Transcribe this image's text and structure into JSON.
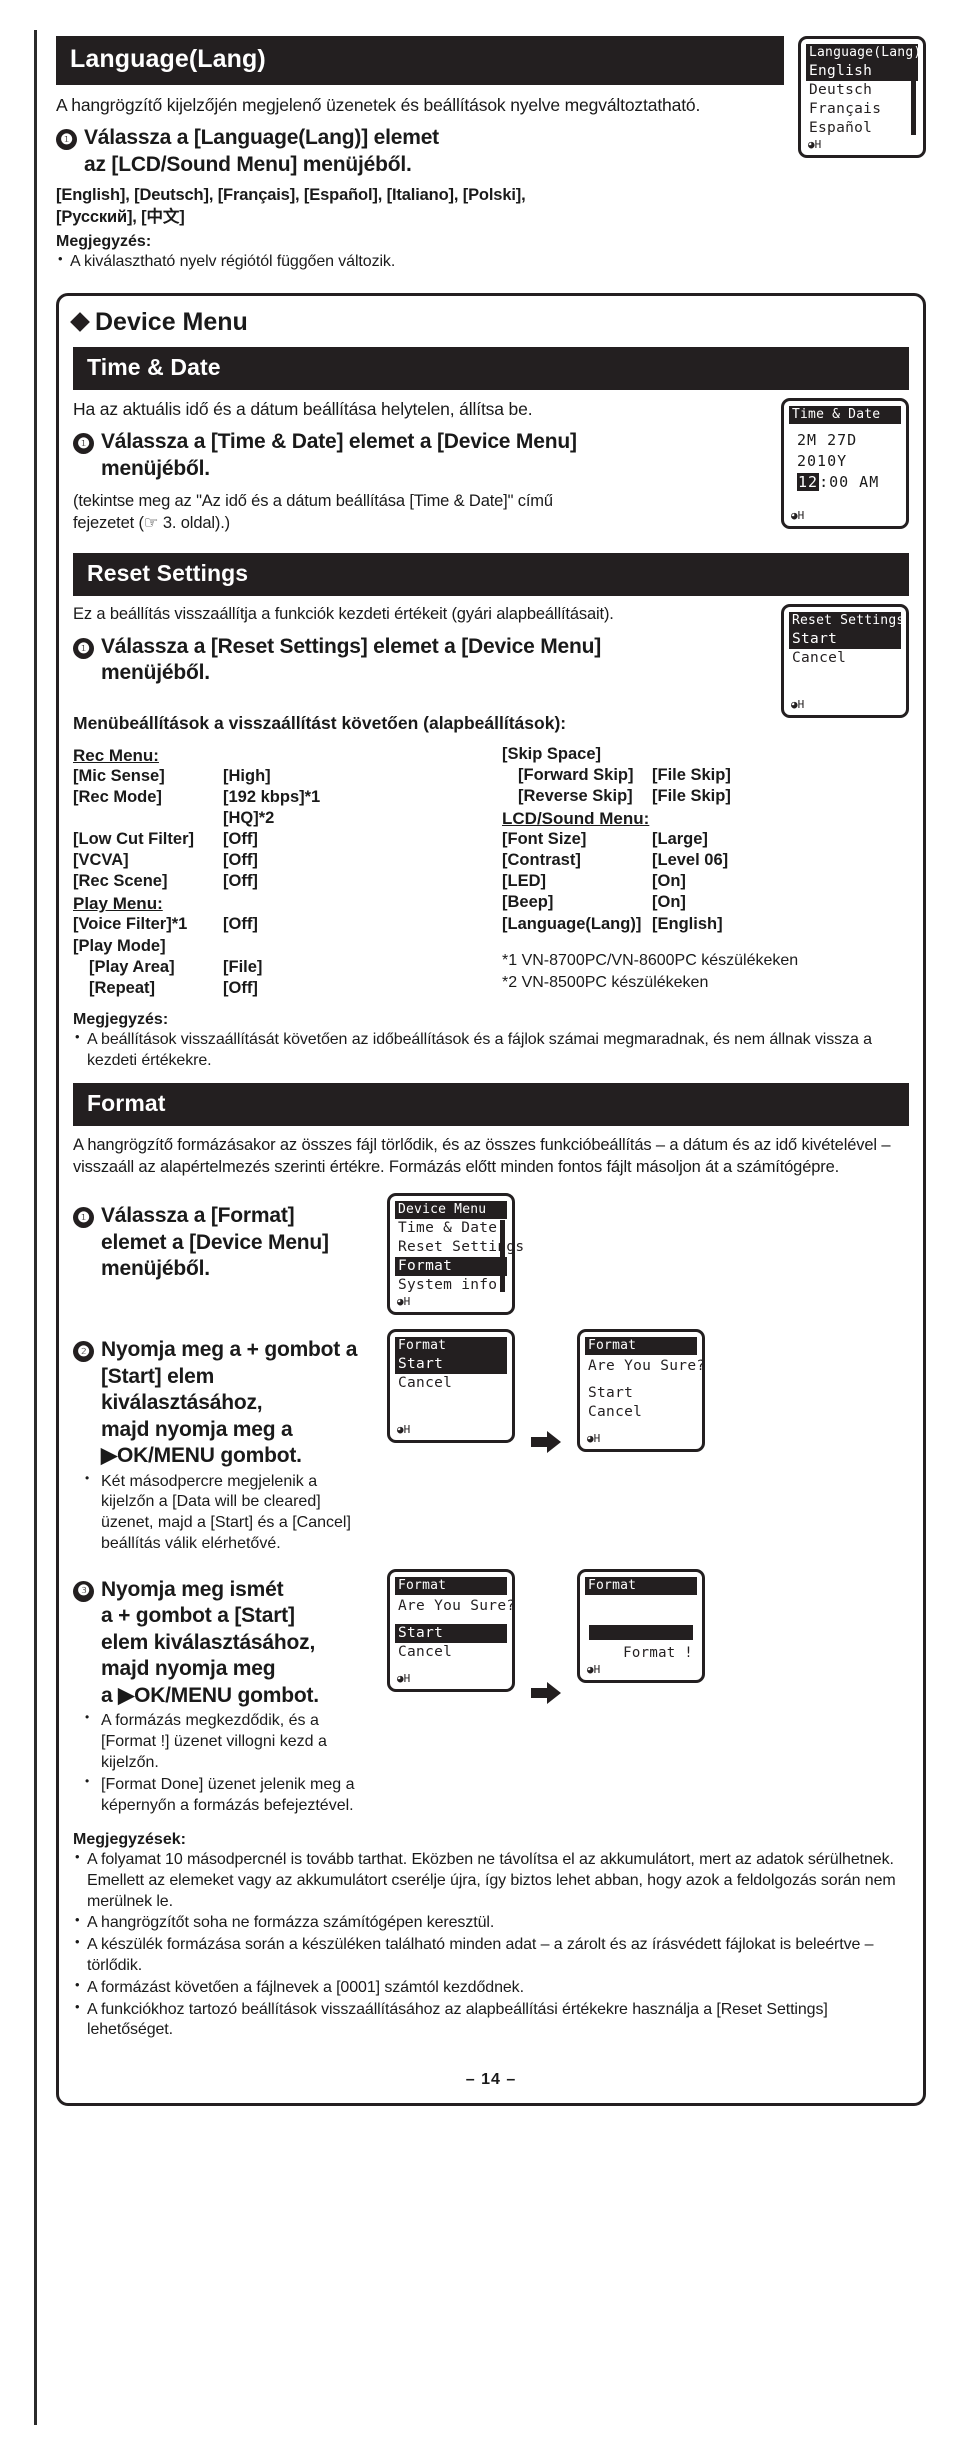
{
  "page_number": "– 14 –",
  "language_section": {
    "heading": "Language(Lang)",
    "intro": "A hangrögzítő kijelzőjén megjelenő üzenetek és beállítások nyelve megváltoztatható.",
    "step1_num": "❶",
    "step1_line1": "Válassza a [Language(Lang)] elemet",
    "step1_line2": "az [LCD/Sound Menu] menüjéből.",
    "options_line1": "[English], [Deutsch], [Français], [Español], [Italiano], [Polski],",
    "options_line2": "[Русский], [中文]",
    "note_heading": "Megjegyzés:",
    "note_item": "A kiválasztható nyelv régiótól függően változik.",
    "lcd": {
      "title": "Language(Lang)",
      "items": [
        "English",
        "Deutsch",
        "Français",
        "Español"
      ],
      "selected": "English",
      "footer": "H"
    }
  },
  "device_menu": {
    "title": "Device Menu",
    "time_date": {
      "heading": "Time & Date",
      "intro": "Ha az aktuális idő és a dátum beállítása helytelen, állítsa be.",
      "step1_num": "❶",
      "step1_line1": "Válassza a [Time & Date] elemet a [Device Menu]",
      "step1_line2": "menüjéből.",
      "ref_line1": "(tekintse meg az \"Az idő és a dátum beállítása [Time & Date]\" című",
      "ref_line2": "fejezetet (☞ 3. oldal).)",
      "lcd": {
        "title": "Time & Date",
        "date_line": "2M 27D 2010Y",
        "time_hl": "12",
        "time_rest": ":00 AM",
        "footer": "H"
      }
    },
    "reset_settings": {
      "heading": "Reset Settings",
      "intro": "Ez a beállítás visszaállítja a funkciók kezdeti értékeit (gyári alapbeállításait).",
      "step1_num": "❶",
      "step1_line1": "Válassza a [Reset Settings] elemet a [Device Menu]",
      "step1_line2": "menüjéből.",
      "defaults_heading": "Menübeállítások a visszaállítást követően (alapbeállítások):",
      "lcd": {
        "title": "Reset Settings",
        "items": [
          "Start",
          "Cancel"
        ],
        "selected": "Start",
        "footer": "H"
      },
      "defaults_left": [
        {
          "type": "group",
          "label": "Rec Menu:"
        },
        {
          "type": "kv",
          "key": "[Mic Sense]",
          "value": "[High]"
        },
        {
          "type": "kv",
          "key": "[Rec Mode]",
          "value": "[192 kbps]*1"
        },
        {
          "type": "kv",
          "key": "",
          "value": "[HQ]*2"
        },
        {
          "type": "kv",
          "key": "[Low Cut Filter]",
          "value": "[Off]"
        },
        {
          "type": "kv",
          "key": "[VCVA]",
          "value": "[Off]"
        },
        {
          "type": "kv",
          "key": "[Rec Scene]",
          "value": "[Off]"
        },
        {
          "type": "group",
          "label": "Play Menu:"
        },
        {
          "type": "kv",
          "key": "[Voice Filter]*1",
          "value": "[Off]"
        },
        {
          "type": "kv",
          "key": "[Play Mode]",
          "value": ""
        },
        {
          "type": "kv-ind",
          "key": "[Play Area]",
          "value": "[File]"
        },
        {
          "type": "kv-ind",
          "key": "[Repeat]",
          "value": "[Off]"
        }
      ],
      "defaults_right": [
        {
          "type": "kv",
          "key": "[Skip Space]",
          "value": ""
        },
        {
          "type": "kv-ind",
          "key": "[Forward Skip]",
          "value": "[File Skip]"
        },
        {
          "type": "kv-ind",
          "key": "[Reverse Skip]",
          "value": "[File Skip]"
        },
        {
          "type": "group",
          "label": "LCD/Sound Menu:"
        },
        {
          "type": "kv",
          "key": "[Font Size]",
          "value": "[Large]"
        },
        {
          "type": "kv",
          "key": "[Contrast]",
          "value": "[Level 06]"
        },
        {
          "type": "kv",
          "key": "[LED]",
          "value": "[On]"
        },
        {
          "type": "kv",
          "key": "[Beep]",
          "value": "[On]"
        },
        {
          "type": "kv",
          "key": "[Language(Lang)]",
          "value": "[English]"
        }
      ],
      "footnote1": "*1  VN-8700PC/VN-8600PC készülékeken",
      "footnote2": "*2  VN-8500PC készülékeken",
      "note_heading": "Megjegyzés:",
      "note_line1": "A beállítások visszaállítását követően az időbeállítások és a fájlok számai megmaradnak,",
      "note_line2": "és nem állnak vissza a kezdeti értékekre."
    },
    "format": {
      "heading": "Format",
      "intro_line1": "A hangrögzítő formázásakor az összes fájl törlődik, és az összes funkcióbeállítás – a dátum és az",
      "intro_line2": "idő kivételével – visszaáll az alapértelmezés szerinti értékre. Formázás előtt minden fontos fájlt",
      "intro_line3": "másoljon át a számítógépre.",
      "step1_num": "❶",
      "step1_line1": "Válassza a [Format]",
      "step1_line2": "elemet a [Device Menu]",
      "step1_line3": "menüjéből.",
      "step1_lcd": {
        "title": "Device Menu",
        "items": [
          "Time & Date",
          "Reset Settings",
          "Format",
          "System info."
        ],
        "selected": "Format",
        "footer": "H"
      },
      "step2_num": "❷",
      "step2_line1": "Nyomja meg a + gombot a",
      "step2_line2": "[Start] elem kiválasztásához,",
      "step2_line3": "majd nyomja meg a",
      "step2_line4": "▶OK/MENU gombot.",
      "step2_sub": "Két másodpercre megjelenik a kijelzőn a [Data will be cleared] üzenet, majd a [Start] és a [Cancel] beállítás válik elérhetővé.",
      "step2_lcd_a": {
        "title": "Format",
        "items": [
          "Start",
          "Cancel"
        ],
        "selected": "Start",
        "footer": "H"
      },
      "step2_lcd_b": {
        "title": "Format",
        "message": "Are You Sure?",
        "items": [
          "Start",
          "Cancel"
        ],
        "selected": "",
        "footer": "H"
      },
      "step3_num": "❸",
      "step3_line1": "Nyomja meg ismét",
      "step3_line2": "a + gombot a [Start]",
      "step3_line3": "elem kiválasztásához,",
      "step3_line4": "majd nyomja meg",
      "step3_line5": "a ▶OK/MENU gombot.",
      "step3_sub1": "A formázás megkezdődik, és a [Format !] üzenet villogni kezd a kijelzőn.",
      "step3_sub2": "[Format Done] üzenet jelenik meg a képernyőn a formázás befejeztével.",
      "step3_lcd_a": {
        "title": "Format",
        "message": "Are You Sure?",
        "items": [
          "Start",
          "Cancel"
        ],
        "selected": "Start",
        "footer": "H"
      },
      "step3_lcd_b": {
        "title": "Format",
        "progress_label": "Format !",
        "footer": "H"
      },
      "notes_heading": "Megjegyzések:",
      "notes": [
        "A folyamat 10 másodpercnél is tovább tarthat. Eközben ne távolítsa el az akkumulátort, mert az adatok sérülhetnek. Emellett az elemeket vagy az akkumulátort cserélje újra, így biztos lehet abban, hogy azok a feldolgozás során nem merülnek le.",
        "A hangrögzítőt soha ne formázza számítógépen keresztül.",
        "A készülék formázása során a készüléken található minden adat – a zárolt és az írásvédett fájlokat is beleértve – törlődik.",
        "A formázást követően a fájlnevek a [0001] számtól kezdődnek.",
        "A funkciókhoz tartozó beállítások visszaállításához az alapbeállítási értékekre használja a [Reset Settings] lehetőséget."
      ]
    }
  }
}
